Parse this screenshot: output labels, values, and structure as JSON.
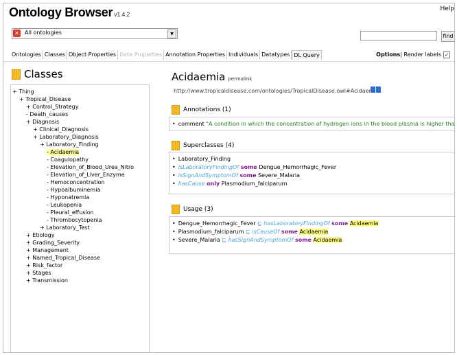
{
  "app": {
    "title": "Ontology Browser",
    "version": "v1.4.2",
    "help": "Help"
  },
  "ontology_select": {
    "value": "All ontologies",
    "dropdown_icon": "triangle-down"
  },
  "search": {
    "value": "",
    "button": "find"
  },
  "tabs": [
    {
      "label": "Ontologies",
      "state": "normal"
    },
    {
      "label": "Classes",
      "state": "normal"
    },
    {
      "label": "Object Properties",
      "state": "normal"
    },
    {
      "label": "Data Properties",
      "state": "dim"
    },
    {
      "label": "Annotation Properties",
      "state": "normal"
    },
    {
      "label": "Individuals",
      "state": "normal"
    },
    {
      "label": "Datatypes",
      "state": "normal"
    },
    {
      "label": "DL Query",
      "state": "active"
    }
  ],
  "options": {
    "label": "Options",
    "render_labels": "Render labels",
    "render_checked": true
  },
  "left": {
    "heading": "Classes",
    "tree": [
      {
        "label": "+ Thing",
        "indent": 0
      },
      {
        "label": "+ Tropical_Disease",
        "indent": 1
      },
      {
        "label": "+ Control_Strategy",
        "indent": 2
      },
      {
        "label": "- Death_causes",
        "indent": 2
      },
      {
        "label": "+ Diagnosis",
        "indent": 2
      },
      {
        "label": "+ Clinical_Diagnosis",
        "indent": 3
      },
      {
        "label": "+ Laboratory_Diagnosis",
        "indent": 3
      },
      {
        "label": "+ Laboratory_Finding",
        "indent": 4
      },
      {
        "label": "- Acidaemia",
        "indent": 5,
        "selected": true
      },
      {
        "label": "- Coagulopathy",
        "indent": 5
      },
      {
        "label": "- Elevation_of_Blood_Urea_Nitro",
        "indent": 5
      },
      {
        "label": "- Elevation_of_Liver_Enzyme",
        "indent": 5
      },
      {
        "label": "- Hemoconcentration",
        "indent": 5
      },
      {
        "label": "- Hypoalbuminemia",
        "indent": 5
      },
      {
        "label": "- Hyponatremia",
        "indent": 5
      },
      {
        "label": "- Leukopenia",
        "indent": 5
      },
      {
        "label": "- Pleural_effusion",
        "indent": 5
      },
      {
        "label": "- Thrombocytopenia",
        "indent": 5
      },
      {
        "label": "+ Laboratory_Test",
        "indent": 4
      },
      {
        "label": "+ Etiology",
        "indent": 2
      },
      {
        "label": "+ Grading_Severity",
        "indent": 2
      },
      {
        "label": "+ Management",
        "indent": 2
      },
      {
        "label": "+ Named_Tropical_Disease",
        "indent": 2
      },
      {
        "label": "+ Risk_factor",
        "indent": 2
      },
      {
        "label": "+ Stages",
        "indent": 2
      },
      {
        "label": "+ Transmission",
        "indent": 2
      }
    ]
  },
  "entity": {
    "name": "Acidaemia",
    "permalink": "permalink",
    "uri": "http://www.tropicaldisease.com/ontologies/TropicalDisease.owl#Acidaemia"
  },
  "annotations": {
    "heading": "Annotations (1)",
    "items": [
      {
        "property": "comment",
        "value": "\"A condition in which the concentration of hydrogen ions in the blood plasma is higher than normal.\""
      }
    ]
  },
  "superclasses": {
    "heading": "Superclasses (4)",
    "items": [
      {
        "prop": "",
        "kw": "",
        "filler": "Laboratory_Finding"
      },
      {
        "prop": "isLaboratoryFindingOf",
        "kw": "some",
        "filler": "Dengue_Hemorrhagic_Fever"
      },
      {
        "prop": "isSignAndSymptomOf",
        "kw": "some",
        "filler": "Severe_Malaria"
      },
      {
        "prop": "hasCause",
        "kw": "only",
        "filler": "Plasmodium_falciparum"
      }
    ]
  },
  "usage": {
    "heading": "Usage (3)",
    "items": [
      {
        "subject": "Dengue_Hemorrhagic_Fever",
        "sep": "⊑",
        "prop": "hasLaboratoryFindingOf",
        "kw": "some",
        "filler": "Acidaemia"
      },
      {
        "subject": "Plasmodium_falciparum",
        "sep": "⊑",
        "prop": "isCauseOf",
        "kw": "some",
        "filler": "Acidaemia"
      },
      {
        "subject": "Severe_Malaria",
        "sep": "⊑",
        "prop": "hasSignAndSymptomOf",
        "kw": "some",
        "filler": "Acidaemia"
      }
    ]
  },
  "colors": {
    "icon_yellow": "#f3b923",
    "property_blue": "#4aa4d6",
    "keyword_purple": "#7b1d8a",
    "comment_green": "#26801f",
    "highlight": "#ffff80"
  }
}
